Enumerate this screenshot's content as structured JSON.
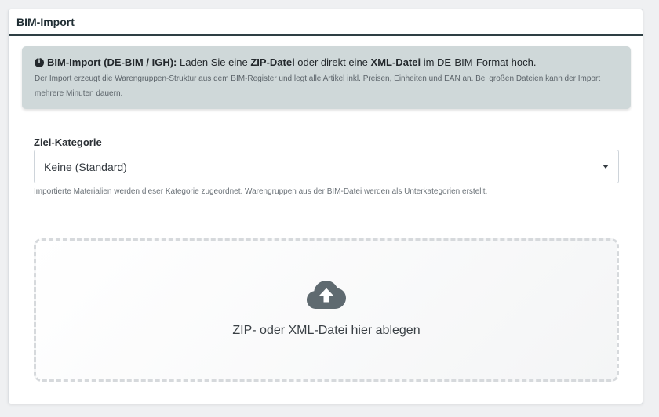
{
  "card": {
    "title": "BIM-Import"
  },
  "alert": {
    "icon": "info-circle-icon",
    "strong_prefix": "BIM-Import (DE-BIM / IGH):",
    "text_a": " Laden Sie eine ",
    "zip_label": "ZIP-Datei",
    "text_b": " oder direkt eine ",
    "xml_label": "XML-Datei",
    "text_c": " im DE-BIM-Format hoch.",
    "description": "Der Import erzeugt die Warengruppen-Struktur aus dem BIM-Register und legt alle Artikel inkl. Preisen, Einheiten und EAN an. Bei großen Dateien kann der Import mehrere Minuten dauern."
  },
  "target_category": {
    "label": "Ziel-Kategorie",
    "selected": "Keine (Standard)",
    "help": "Importierte Materialien werden dieser Kategorie zugeordnet. Warengruppen aus der BIM-Datei werden als Unterkategorien erstellt."
  },
  "dropzone": {
    "icon": "cloud-upload-icon",
    "text": "ZIP- oder XML-Datei hier ablegen"
  },
  "colors": {
    "header_rule": "#2e3f44",
    "alert_bg": "#cfd8d9",
    "icon": "#5f6a70"
  }
}
